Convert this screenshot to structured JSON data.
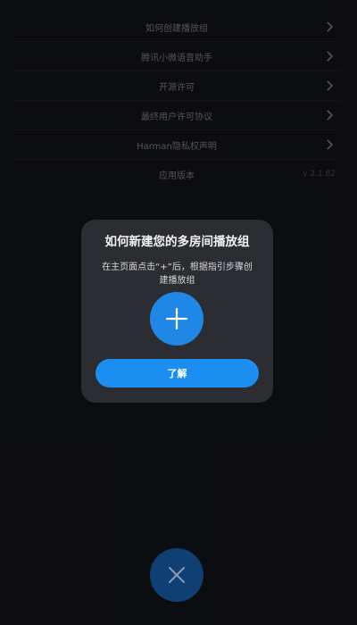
{
  "menu": {
    "items": [
      {
        "label": "如何创建播放组",
        "icon": "chevron-right-icon"
      },
      {
        "label": "腾讯小微语音助手",
        "icon": "chevron-right-icon"
      },
      {
        "label": "开源许可",
        "icon": "chevron-right-icon"
      },
      {
        "label": "最终用户许可协议",
        "icon": "chevron-right-icon"
      },
      {
        "label": "Harman隐私权声明",
        "icon": "chevron-right-icon"
      }
    ],
    "version_label": "应用版本",
    "version_value": "v 2.1.82"
  },
  "dialog": {
    "title": "如何新建您的多房间播放组",
    "body": "在主页面点击“+”后，根据指引步骤创建播放组",
    "icon": "plus-icon",
    "confirm_label": "了解"
  },
  "close_button": {
    "icon": "close-icon"
  },
  "colors": {
    "accent": "#1b8ef0",
    "dialog_bg": "#2b2d33",
    "screen_bg": "#111216",
    "close_bg": "#0f3f73"
  }
}
